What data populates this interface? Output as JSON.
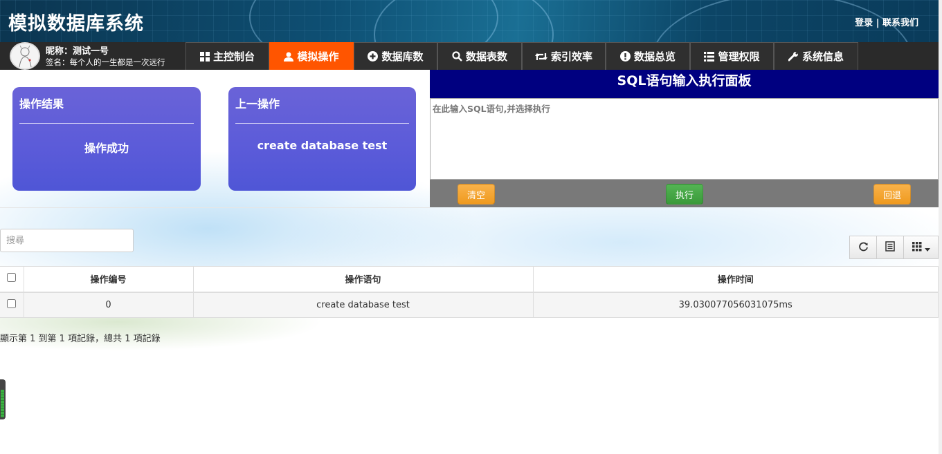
{
  "header": {
    "app_title": "模拟数据库系统",
    "login_label": "登录",
    "separator": " | ",
    "contact_label": "联系我们"
  },
  "user": {
    "nickname": "昵称：测试一号",
    "signature": "签名：每个人的一生都是一次远行"
  },
  "nav": {
    "tabs": [
      {
        "label": "主控制台",
        "icon": "grid-icon",
        "active": false
      },
      {
        "label": "模拟操作",
        "icon": "user-icon",
        "active": true
      },
      {
        "label": "数据库数",
        "icon": "plus-circle-icon",
        "active": false
      },
      {
        "label": "数据表数",
        "icon": "search-icon",
        "active": false
      },
      {
        "label": "索引效率",
        "icon": "retweet-icon",
        "active": false
      },
      {
        "label": "数据总览",
        "icon": "exclamation-circle-icon",
        "active": false
      },
      {
        "label": "管理权限",
        "icon": "list-icon",
        "active": false
      },
      {
        "label": "系统信息",
        "icon": "wrench-icon",
        "active": false
      }
    ]
  },
  "cards": {
    "result": {
      "title": "操作结果",
      "value": "操作成功"
    },
    "last": {
      "title": "上一操作",
      "value": "create database test"
    }
  },
  "sql_panel": {
    "title": "SQL语句输入执行面板",
    "placeholder": "在此输入SQL语句,并选择执行",
    "clear_label": "清空",
    "execute_label": "执行",
    "rollback_label": "回退"
  },
  "table": {
    "search_placeholder": "搜尋",
    "columns": [
      "操作编号",
      "操作语句",
      "操作时间"
    ],
    "rows": [
      {
        "id": "0",
        "statement": "create database test",
        "time": "39.030077056031075ms"
      }
    ],
    "page_info": "顯示第 1 到第 1 項記錄，總共 1 項記錄",
    "toolbar_icons": [
      "refresh-icon",
      "toggle-view-icon",
      "columns-icon"
    ]
  },
  "colors": {
    "active_tab": "#ff5500",
    "sql_header": "#000080",
    "card": "#5b5bd9",
    "warn_button": "#f0a030",
    "ok_button": "#3a9a3a"
  }
}
